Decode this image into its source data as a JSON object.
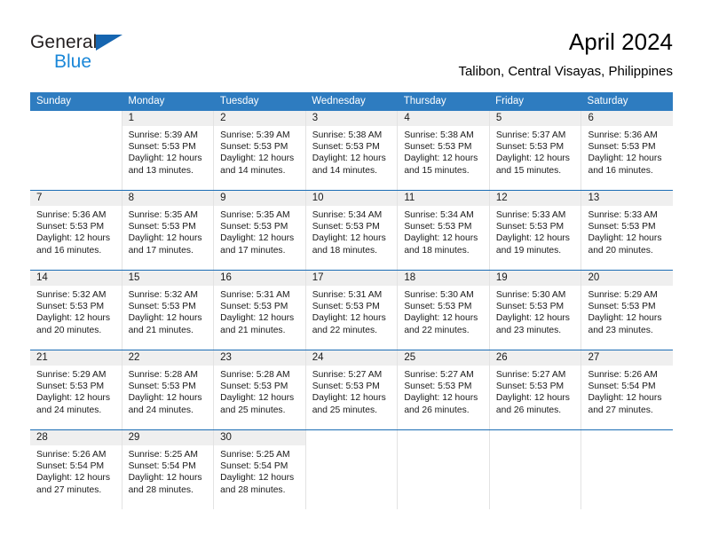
{
  "brand": {
    "name_part1": "General",
    "name_part2": "Blue",
    "logo_icon": "triangle-flag-icon"
  },
  "header": {
    "title": "April 2024",
    "location": "Talibon, Central Visayas, Philippines"
  },
  "colors": {
    "header_blue": "#2e7cc0",
    "divider_blue": "#1b6db5",
    "daynum_band": "#efefef",
    "brand_blue": "#1a87d8"
  },
  "weekdays": [
    "Sunday",
    "Monday",
    "Tuesday",
    "Wednesday",
    "Thursday",
    "Friday",
    "Saturday"
  ],
  "weeks": [
    [
      {
        "empty": true
      },
      {
        "day": "1",
        "sunrise": "Sunrise: 5:39 AM",
        "sunset": "Sunset: 5:53 PM",
        "daylight": "Daylight: 12 hours and 13 minutes."
      },
      {
        "day": "2",
        "sunrise": "Sunrise: 5:39 AM",
        "sunset": "Sunset: 5:53 PM",
        "daylight": "Daylight: 12 hours and 14 minutes."
      },
      {
        "day": "3",
        "sunrise": "Sunrise: 5:38 AM",
        "sunset": "Sunset: 5:53 PM",
        "daylight": "Daylight: 12 hours and 14 minutes."
      },
      {
        "day": "4",
        "sunrise": "Sunrise: 5:38 AM",
        "sunset": "Sunset: 5:53 PM",
        "daylight": "Daylight: 12 hours and 15 minutes."
      },
      {
        "day": "5",
        "sunrise": "Sunrise: 5:37 AM",
        "sunset": "Sunset: 5:53 PM",
        "daylight": "Daylight: 12 hours and 15 minutes."
      },
      {
        "day": "6",
        "sunrise": "Sunrise: 5:36 AM",
        "sunset": "Sunset: 5:53 PM",
        "daylight": "Daylight: 12 hours and 16 minutes."
      }
    ],
    [
      {
        "day": "7",
        "sunrise": "Sunrise: 5:36 AM",
        "sunset": "Sunset: 5:53 PM",
        "daylight": "Daylight: 12 hours and 16 minutes."
      },
      {
        "day": "8",
        "sunrise": "Sunrise: 5:35 AM",
        "sunset": "Sunset: 5:53 PM",
        "daylight": "Daylight: 12 hours and 17 minutes."
      },
      {
        "day": "9",
        "sunrise": "Sunrise: 5:35 AM",
        "sunset": "Sunset: 5:53 PM",
        "daylight": "Daylight: 12 hours and 17 minutes."
      },
      {
        "day": "10",
        "sunrise": "Sunrise: 5:34 AM",
        "sunset": "Sunset: 5:53 PM",
        "daylight": "Daylight: 12 hours and 18 minutes."
      },
      {
        "day": "11",
        "sunrise": "Sunrise: 5:34 AM",
        "sunset": "Sunset: 5:53 PM",
        "daylight": "Daylight: 12 hours and 18 minutes."
      },
      {
        "day": "12",
        "sunrise": "Sunrise: 5:33 AM",
        "sunset": "Sunset: 5:53 PM",
        "daylight": "Daylight: 12 hours and 19 minutes."
      },
      {
        "day": "13",
        "sunrise": "Sunrise: 5:33 AM",
        "sunset": "Sunset: 5:53 PM",
        "daylight": "Daylight: 12 hours and 20 minutes."
      }
    ],
    [
      {
        "day": "14",
        "sunrise": "Sunrise: 5:32 AM",
        "sunset": "Sunset: 5:53 PM",
        "daylight": "Daylight: 12 hours and 20 minutes."
      },
      {
        "day": "15",
        "sunrise": "Sunrise: 5:32 AM",
        "sunset": "Sunset: 5:53 PM",
        "daylight": "Daylight: 12 hours and 21 minutes."
      },
      {
        "day": "16",
        "sunrise": "Sunrise: 5:31 AM",
        "sunset": "Sunset: 5:53 PM",
        "daylight": "Daylight: 12 hours and 21 minutes."
      },
      {
        "day": "17",
        "sunrise": "Sunrise: 5:31 AM",
        "sunset": "Sunset: 5:53 PM",
        "daylight": "Daylight: 12 hours and 22 minutes."
      },
      {
        "day": "18",
        "sunrise": "Sunrise: 5:30 AM",
        "sunset": "Sunset: 5:53 PM",
        "daylight": "Daylight: 12 hours and 22 minutes."
      },
      {
        "day": "19",
        "sunrise": "Sunrise: 5:30 AM",
        "sunset": "Sunset: 5:53 PM",
        "daylight": "Daylight: 12 hours and 23 minutes."
      },
      {
        "day": "20",
        "sunrise": "Sunrise: 5:29 AM",
        "sunset": "Sunset: 5:53 PM",
        "daylight": "Daylight: 12 hours and 23 minutes."
      }
    ],
    [
      {
        "day": "21",
        "sunrise": "Sunrise: 5:29 AM",
        "sunset": "Sunset: 5:53 PM",
        "daylight": "Daylight: 12 hours and 24 minutes."
      },
      {
        "day": "22",
        "sunrise": "Sunrise: 5:28 AM",
        "sunset": "Sunset: 5:53 PM",
        "daylight": "Daylight: 12 hours and 24 minutes."
      },
      {
        "day": "23",
        "sunrise": "Sunrise: 5:28 AM",
        "sunset": "Sunset: 5:53 PM",
        "daylight": "Daylight: 12 hours and 25 minutes."
      },
      {
        "day": "24",
        "sunrise": "Sunrise: 5:27 AM",
        "sunset": "Sunset: 5:53 PM",
        "daylight": "Daylight: 12 hours and 25 minutes."
      },
      {
        "day": "25",
        "sunrise": "Sunrise: 5:27 AM",
        "sunset": "Sunset: 5:53 PM",
        "daylight": "Daylight: 12 hours and 26 minutes."
      },
      {
        "day": "26",
        "sunrise": "Sunrise: 5:27 AM",
        "sunset": "Sunset: 5:53 PM",
        "daylight": "Daylight: 12 hours and 26 minutes."
      },
      {
        "day": "27",
        "sunrise": "Sunrise: 5:26 AM",
        "sunset": "Sunset: 5:54 PM",
        "daylight": "Daylight: 12 hours and 27 minutes."
      }
    ],
    [
      {
        "day": "28",
        "sunrise": "Sunrise: 5:26 AM",
        "sunset": "Sunset: 5:54 PM",
        "daylight": "Daylight: 12 hours and 27 minutes."
      },
      {
        "day": "29",
        "sunrise": "Sunrise: 5:25 AM",
        "sunset": "Sunset: 5:54 PM",
        "daylight": "Daylight: 12 hours and 28 minutes."
      },
      {
        "day": "30",
        "sunrise": "Sunrise: 5:25 AM",
        "sunset": "Sunset: 5:54 PM",
        "daylight": "Daylight: 12 hours and 28 minutes."
      },
      {
        "empty": true
      },
      {
        "empty": true
      },
      {
        "empty": true
      },
      {
        "empty": true
      }
    ]
  ]
}
